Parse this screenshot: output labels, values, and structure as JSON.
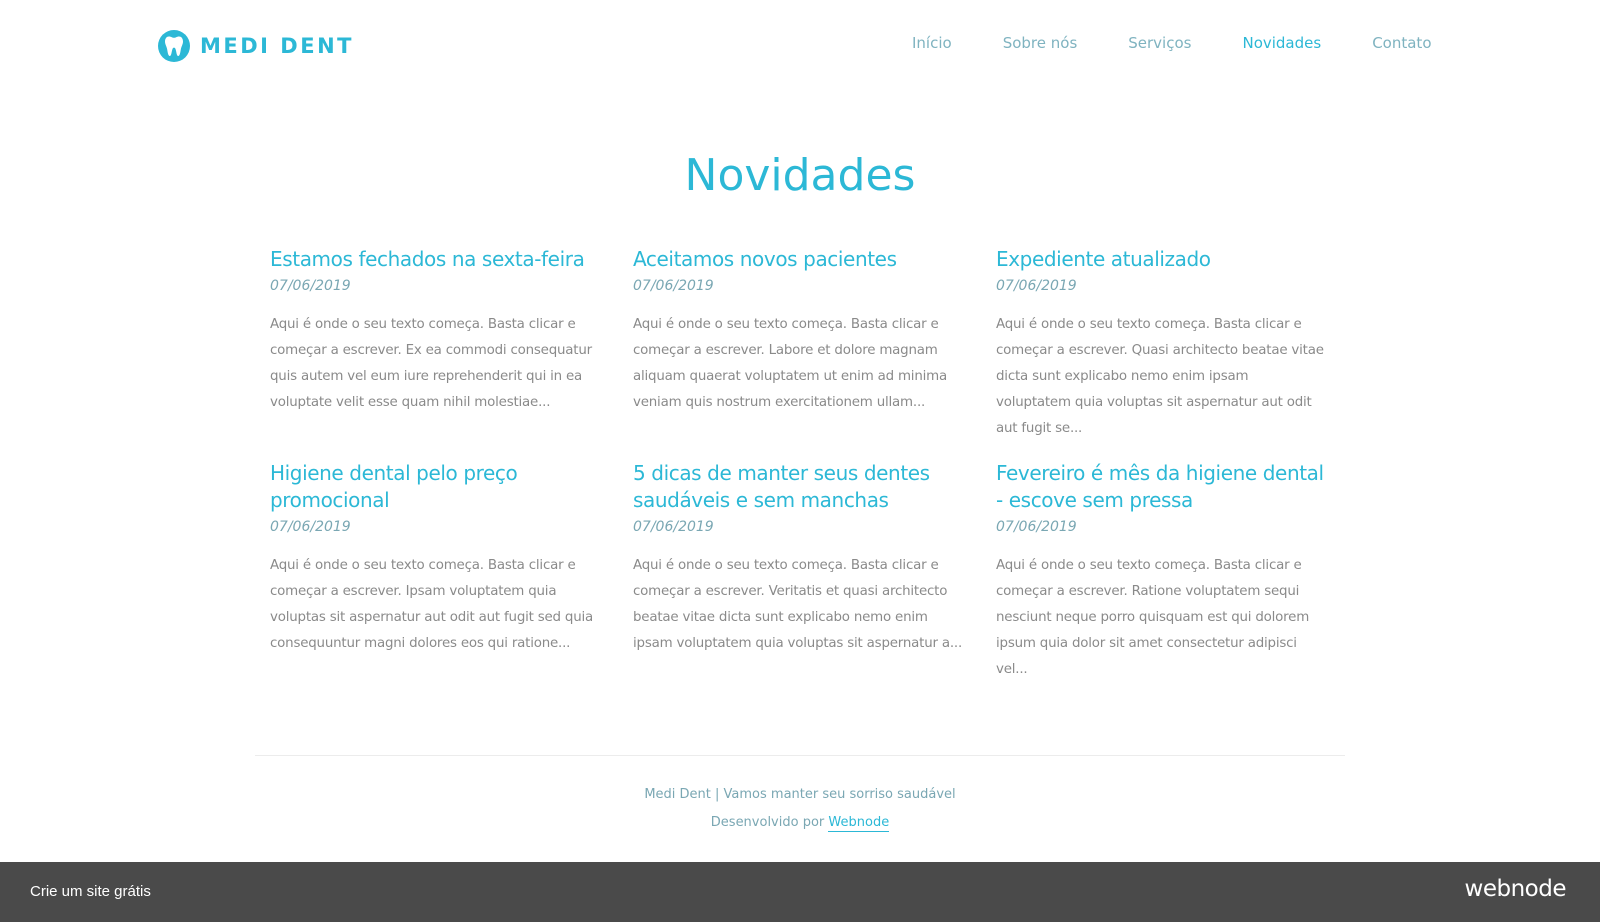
{
  "brand": {
    "name": "MEDI DENT",
    "logo_icon": "tooth-icon",
    "accent_color": "#2cb8d6"
  },
  "nav": {
    "items": [
      {
        "label": "Início",
        "active": false
      },
      {
        "label": "Sobre nós",
        "active": false
      },
      {
        "label": "Serviços",
        "active": false
      },
      {
        "label": "Novidades",
        "active": true
      },
      {
        "label": "Contato",
        "active": false
      }
    ]
  },
  "page": {
    "title": "Novidades"
  },
  "articles": [
    {
      "title": "Estamos fechados na sexta-feira",
      "date": "07/06/2019",
      "excerpt": "Aqui é onde o seu texto começa. Basta clicar e começar a escrever. Ex ea commodi consequatur quis autem vel eum iure reprehenderit qui in ea voluptate velit esse quam nihil molestiae..."
    },
    {
      "title": "Aceitamos novos pacientes",
      "date": "07/06/2019",
      "excerpt": "Aqui é onde o seu texto começa. Basta clicar e começar a escrever. Labore et dolore magnam aliquam quaerat voluptatem ut enim ad minima veniam quis nostrum exercitationem ullam..."
    },
    {
      "title": "Expediente atualizado",
      "date": "07/06/2019",
      "excerpt": "Aqui é onde o seu texto começa. Basta clicar e começar a escrever. Quasi architecto beatae vitae dicta sunt explicabo nemo enim ipsam voluptatem quia voluptas sit aspernatur aut odit aut fugit se..."
    },
    {
      "title": "Higiene dental pelo preço promocional",
      "date": "07/06/2019",
      "excerpt": "Aqui é onde o seu texto começa. Basta clicar e começar a escrever. Ipsam voluptatem quia voluptas sit aspernatur aut odit aut fugit sed quia consequuntur magni dolores eos qui ratione..."
    },
    {
      "title": "5 dicas de manter seus dentes saudáveis e sem manchas",
      "date": "07/06/2019",
      "excerpt": "Aqui é onde o seu texto começa. Basta clicar e começar a escrever. Veritatis et quasi architecto beatae vitae dicta sunt explicabo nemo enim ipsam voluptatem quia voluptas sit aspernatur a..."
    },
    {
      "title": "Fevereiro é mês da higiene dental - escove sem pressa",
      "date": "07/06/2019",
      "excerpt": "Aqui é onde o seu texto começa. Basta clicar e começar a escrever. Ratione voluptatem sequi nesciunt neque porro quisquam est qui dolorem ipsum quia dolor sit amet consectetur adipisci vel..."
    }
  ],
  "footer": {
    "tagline": "Medi Dent | Vamos manter seu sorriso saudável",
    "powered_prefix": "Desenvolvido por",
    "powered_link": "Webnode"
  },
  "promo_bar": {
    "cta": "Crie um site grátis",
    "brand": "webnode",
    "background": "#4a4a4a"
  }
}
